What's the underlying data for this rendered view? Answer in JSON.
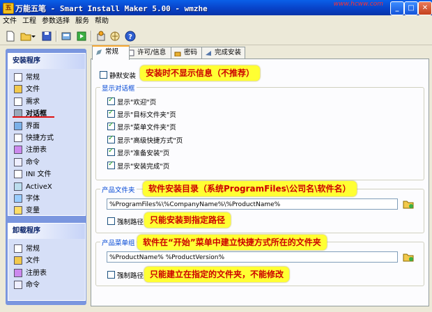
{
  "window": {
    "title": "万能五笔 - Smart Install Maker 5.00 - wmzhe",
    "watermark": "www.hcww.com"
  },
  "menu": [
    "文件",
    "工程",
    "参数选择",
    "服务",
    "帮助"
  ],
  "sidebar": {
    "install_title": "安装程序",
    "install_items": [
      "常规",
      "文件",
      "需求",
      "对话框",
      "界面",
      "快捷方式",
      "注册表",
      "命令",
      "INI 文件",
      "ActiveX",
      "字体",
      "变量"
    ],
    "uninstall_title": "卸载程序",
    "uninstall_items": [
      "常规",
      "文件",
      "注册表",
      "命令"
    ]
  },
  "tabs": [
    "常规",
    "许可/信息",
    "密码",
    "完成安装"
  ],
  "silent": {
    "label": "静默安装",
    "checked": false,
    "note": "安装时不显示信息（不推荐）"
  },
  "dialogs": {
    "legend": "显示对话框",
    "items": [
      {
        "label": "显示\"欢迎\"页",
        "checked": true
      },
      {
        "label": "显示\"目标文件夹\"页",
        "checked": true
      },
      {
        "label": "显示\"菜单文件夹\"页",
        "checked": true
      },
      {
        "label": "显示\"高级快捷方式\"页",
        "checked": true
      },
      {
        "label": "显示\"准备安装\"页",
        "checked": true
      },
      {
        "label": "显示\"安装完成\"页",
        "checked": true
      }
    ]
  },
  "product_folder": {
    "legend": "产品文件夹",
    "value": "%ProgramFiles%\\%CompanyName%\\%ProductName%",
    "force_label": "强制路径",
    "force_checked": false,
    "note": "软件安装目录（系统ProgramFiles\\公司名\\软件名）",
    "force_note": "只能安装到指定路径"
  },
  "product_menu": {
    "legend": "产品菜单组",
    "value": "%ProductName% %ProductVersion%",
    "force_label": "强制路径",
    "force_checked": false,
    "note": "软件在“开始”菜单中建立快捷方式所在的文件夹",
    "force_note": "只能建立在指定的文件夹，不能修改"
  }
}
